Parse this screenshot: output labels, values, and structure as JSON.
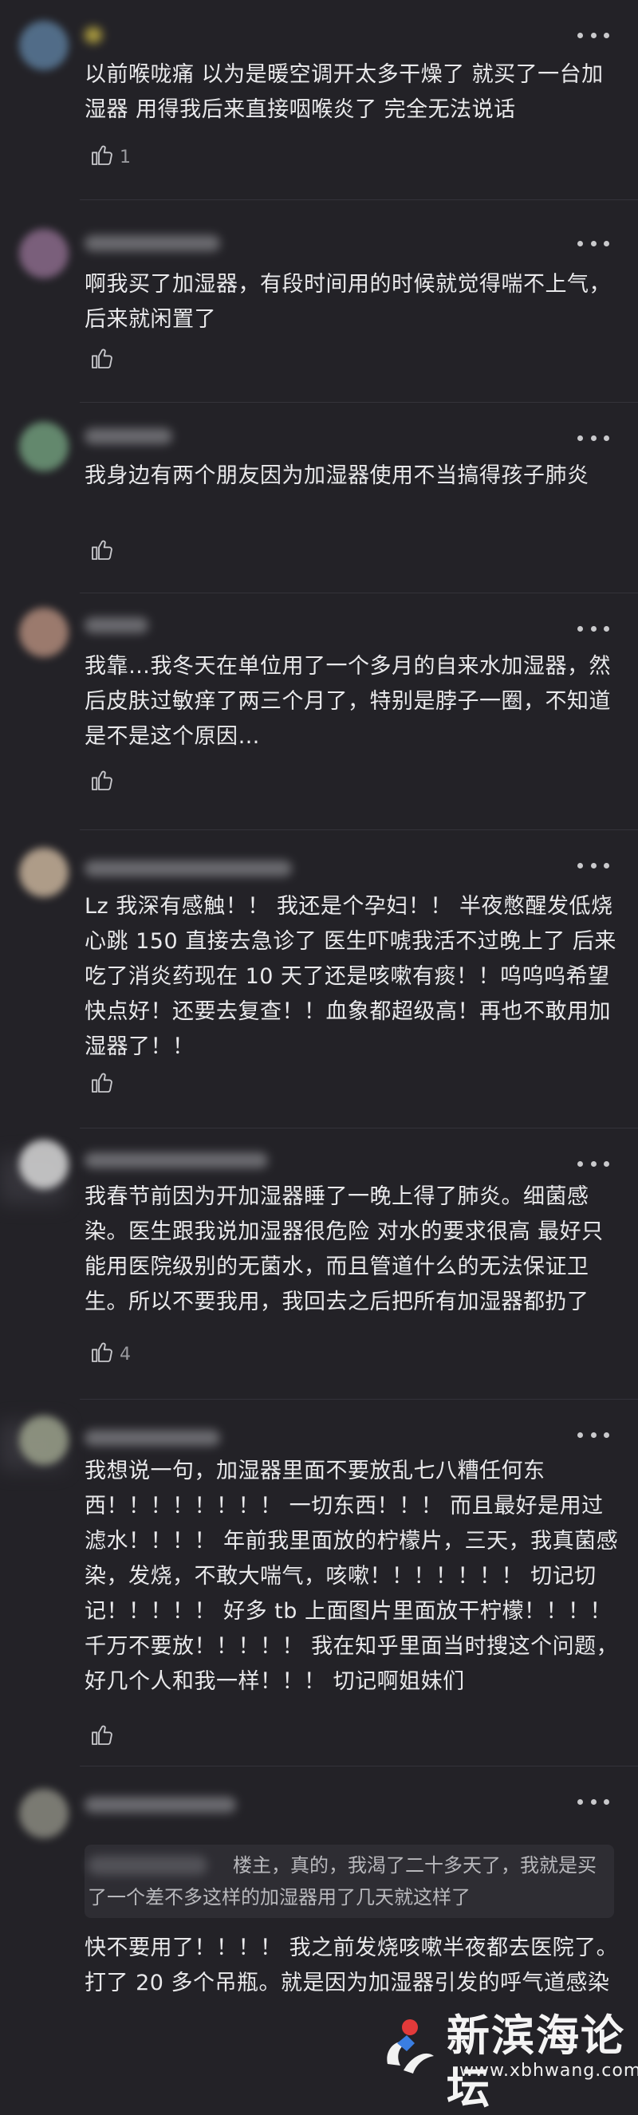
{
  "comments": [
    {
      "text": "以前喉咙痛 以为是暖空调开太多干燥了 就买了一台加湿器 用得我后来直接咽喉炎了 完全无法说话",
      "likes": "1",
      "avatar_color": "#5a7a99"
    },
    {
      "text": "啊我买了加湿器，有段时间用的时候就觉得喘不上气，后来就闲置了",
      "likes": "",
      "avatar_color": "#8a6a8a"
    },
    {
      "text": "我身边有两个朋友因为加湿器使用不当搞得孩子肺炎",
      "likes": "",
      "avatar_color": "#6f9a7a"
    },
    {
      "text": "我靠…我冬天在单位用了一个多月的自来水加湿器，然后皮肤过敏痒了两三个月了，特别是脖子一圈，不知道是不是这个原因…",
      "likes": "",
      "avatar_color": "#b08a7a"
    },
    {
      "text": "Lz 我深有感触！！ 我还是个孕妇！！ 半夜憋醒发低烧心跳 150 直接去急诊了 医生吓唬我活不过晚上了 后来吃了消炎药现在 10 天了还是咳嗽有痰！！呜呜呜希望快点好！还要去复查！！血象都超级高！再也不敢用加湿器了！！",
      "likes": "",
      "avatar_color": "#c7b29a"
    },
    {
      "text": "我春节前因为开加湿器睡了一晚上得了肺炎。细菌感染。医生跟我说加湿器很危险 对水的要求很高 最好只能用医院级别的无菌水，而且管道什么的无法保证卫生。所以不要我用，我回去之后把所有加湿器都扔了",
      "likes": "4",
      "avatar_color": "#d8d8d8"
    },
    {
      "text": "我想说一句，加湿器里面不要放乱七八糟任何东西！！！！！！！！ 一切东西！！！ 而且最好是用过滤水！！！！ 年前我里面放的柠檬片，三天，我真菌感染，发烧，不敢大喘气，咳嗽！！！！！！！ 切记切记！！！！！ 好多 tb 上面图片里面放干柠檬！！！！ 千万不要放！！！！！ 我在知乎里面当时搜这个问题，好几个人和我一样！！！ 切记啊姐妹们",
      "likes": "",
      "avatar_color": "#9aa08a"
    },
    {
      "quote": "楼主，真的，我渴了二十多天了，我就是买了一个差不多这样的加湿器用了几天就这样了",
      "text": "快不要用了！！！！ 我之前发烧咳嗽半夜都去医院了。打了 20 多个吊瓶。就是因为加湿器引发的呼气道感染",
      "likes": "",
      "avatar_color": "#8a8a80"
    }
  ],
  "watermark": {
    "title": "新滨海论坛",
    "url": "www.xbhwang.com"
  }
}
